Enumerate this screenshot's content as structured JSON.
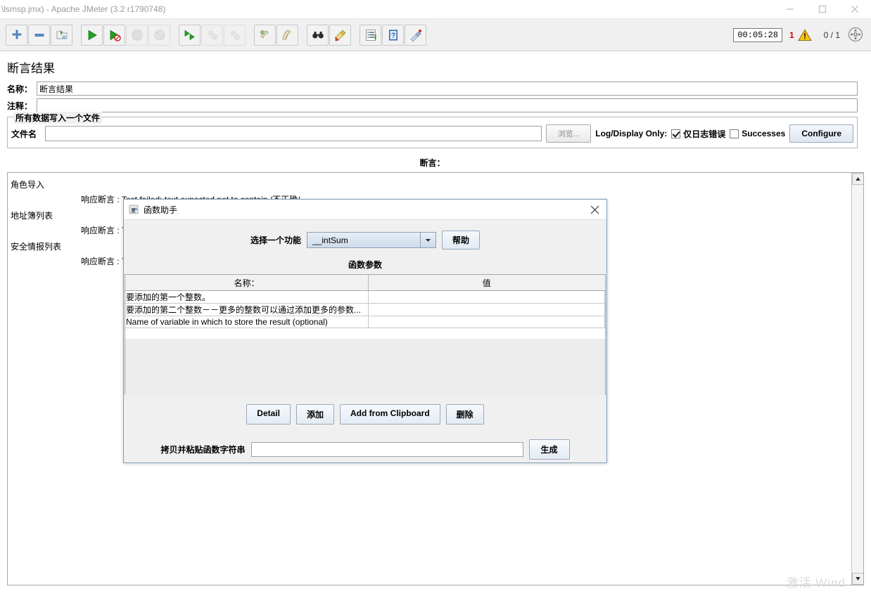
{
  "window": {
    "title": "\\lsmsp.jmx) - Apache JMeter (3.2 r1790748)",
    "minimize_label": "minimize",
    "maximize_label": "maximize",
    "close_label": "close"
  },
  "toolbar": {
    "buttons": [
      {
        "name": "add-icon",
        "label": "新建"
      },
      {
        "name": "remove-icon",
        "label": "移除"
      },
      {
        "name": "open-template-icon",
        "label": "模板"
      },
      {
        "name": "start-icon",
        "label": "启动"
      },
      {
        "name": "start-no-pauses-icon",
        "label": "无间隔启动"
      },
      {
        "name": "stop-icon",
        "label": "停止"
      },
      {
        "name": "shutdown-icon",
        "label": "关闭"
      },
      {
        "name": "remote-start-all-icon",
        "label": "远程启动全部"
      },
      {
        "name": "remote-stop-all-icon",
        "label": "远程停止全部"
      },
      {
        "name": "remote-shutdown-all-icon",
        "label": "远程关闭全部"
      },
      {
        "name": "clear-icon",
        "label": "清除"
      },
      {
        "name": "clear-all-icon",
        "label": "清除全部"
      },
      {
        "name": "search-icon",
        "label": "查找"
      },
      {
        "name": "reset-search-icon",
        "label": "重置查找"
      },
      {
        "name": "function-list-icon",
        "label": "列表"
      },
      {
        "name": "help-icon",
        "label": "帮助"
      },
      {
        "name": "function-helper-icon",
        "label": "函数助手"
      }
    ],
    "timer": "00:05:28",
    "warning_count": "1",
    "warning_icon": "warning-triangle-icon",
    "thread_count": "0 / 1",
    "expand_icon": "expand-icon"
  },
  "panel": {
    "title": "断言结果",
    "name_label": "名称：",
    "name_value": "断言结果",
    "comment_label": "注释：",
    "comment_value": "",
    "file_group_legend": "所有数据写入一个文件",
    "filename_label": "文件名",
    "filename_value": "",
    "browse_button": "浏览...",
    "log_display_label": "Log/Display Only:",
    "errors_only_label": "仅日志错误",
    "errors_only_checked": true,
    "successes_label": "Successes",
    "successes_checked": false,
    "configure_button": "Configure",
    "assertions_header": "断言："
  },
  "assertions": [
    {
      "sampler": "角色导入",
      "message": "响应断言 : Test failed: text expected not to contain /不正确/"
    },
    {
      "sampler": "地址簿列表",
      "message": "响应断言 : Test failed: text expected not to contain /不正确/"
    },
    {
      "sampler": "安全情报列表",
      "message": "响应断言 : Test failed: text expected not to contain /不正确/"
    }
  ],
  "scrollbar": {
    "up_icon": "scroll-up-arrow-icon",
    "down_icon": "scroll-down-arrow-icon"
  },
  "dialog": {
    "app_icon": "java-cup-icon",
    "title": "函数助手",
    "close_icon": "close-icon",
    "function_label": "选择一个功能",
    "function_value": "__intSum",
    "function_dropdown_icon": "chevron-down-icon",
    "help_button": "帮助",
    "params_caption": "函数参数",
    "table": {
      "columns": [
        "名称：",
        "值"
      ],
      "rows": [
        {
          "name": "要添加的第一个整数。",
          "value": ""
        },
        {
          "name": "要添加的第二个整数－－更多的整数可以通过添加更多的参数...",
          "value": ""
        },
        {
          "name": "Name of variable in which to store the result (optional)",
          "value": ""
        }
      ]
    },
    "buttons": {
      "detail": "Detail",
      "add": "添加",
      "add_from_clipboard": "Add from Clipboard",
      "delete": "删除"
    },
    "paste_label": "拷贝并粘贴函数字符串",
    "paste_value": "",
    "generate_button": "生成"
  },
  "watermark": "激活 Wind"
}
